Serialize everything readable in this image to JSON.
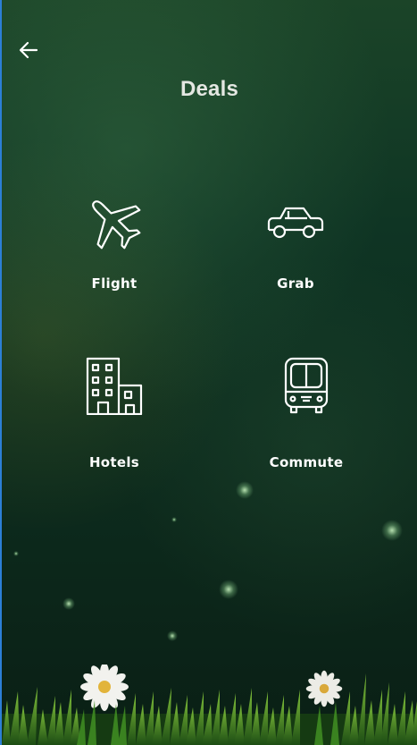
{
  "header": {
    "title": "Deals",
    "back_icon": "arrow-left-icon"
  },
  "deals": [
    {
      "label": "Flight",
      "icon": "airplane-icon"
    },
    {
      "label": "Grab",
      "icon": "car-icon"
    },
    {
      "label": "Hotels",
      "icon": "building-icon"
    },
    {
      "label": "Commute",
      "icon": "bus-icon"
    }
  ],
  "colors": {
    "background_top": "#1b4428",
    "background_bottom": "#0a1f15",
    "text": "#ffffff",
    "title_text": "#e4e7e2"
  }
}
